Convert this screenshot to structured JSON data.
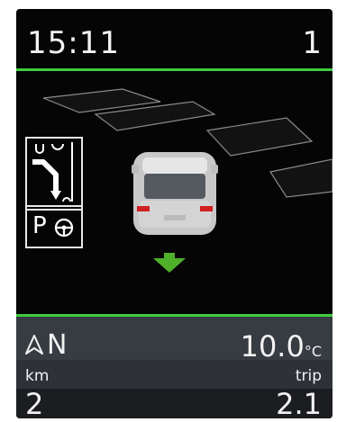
{
  "status": {
    "time": "15:11",
    "gear": "1"
  },
  "indicators": {
    "parking_label": "P"
  },
  "info": {
    "compass_direction": "N",
    "temperature_value": "10.0",
    "temperature_unit": "°C",
    "distance_label": "km",
    "trip_label": "trip",
    "distance_value": "2",
    "trip_value": "2.1"
  },
  "colors": {
    "accent": "#3fcc3f",
    "background": "#050505",
    "panel": "#373b42"
  },
  "icons": [
    "steering-wheel-icon",
    "parking-maneuver-icon",
    "compass-arrow-icon",
    "direction-arrow-icon",
    "car-icon"
  ]
}
